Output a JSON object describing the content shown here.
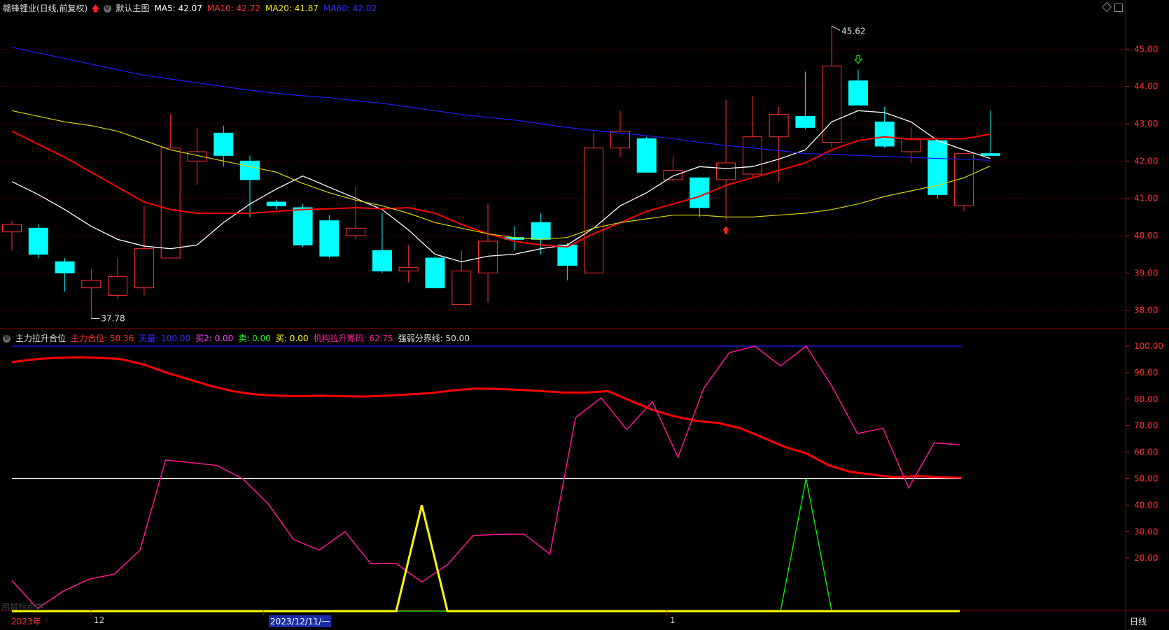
{
  "header": {
    "stock": "赣锋锂业(日线,前复权)",
    "template": "默认主图",
    "ma5": "MA5: 42.07",
    "ma10": "MA10: 42.72",
    "ma20": "MA20: 41.87",
    "ma60": "MA60: 42.02"
  },
  "indicator_header": {
    "name": "主力拉升合位",
    "main": "主力合位: 50.36",
    "sky": "天量: 100.00",
    "buy2": "买2: 0.00",
    "sell": "卖: 0.00",
    "buy": "买: 0.00",
    "inst": "机构拉升筹码: 62.75",
    "line": "强弱分界线: 50.00"
  },
  "bottom": {
    "year": "2023年",
    "m12": "12",
    "date": "2023/12/11/一",
    "m1": "1",
    "period": "日线",
    "hint": "用鼠标点中"
  },
  "colors": {
    "up": "#ff3232",
    "down": "#00ffff",
    "ma5": "#ffffff",
    "ma10": "#ff0000",
    "ma20": "#d8d800",
    "ma60": "#2020ff",
    "inst": "#ff1493",
    "main": "#ff0000",
    "buy": "#ffff00",
    "buy2": "#00ff00",
    "grid": "#5a0000"
  },
  "chart_data": [
    {
      "type": "candlestick",
      "yticks": [
        "45.00",
        "44.00",
        "43.00",
        "42.00",
        "41.00",
        "40.00",
        "39.00",
        "38.00"
      ],
      "ylim": [
        37.6,
        45.85
      ],
      "annotations": {
        "high_label": "45.62",
        "low_label": "37.78"
      },
      "candles": [
        {
          "o": 40.1,
          "c": 40.3,
          "h": 40.4,
          "l": 39.6
        },
        {
          "o": 40.2,
          "c": 39.5,
          "h": 40.3,
          "l": 39.4
        },
        {
          "o": 39.3,
          "c": 39.0,
          "h": 39.4,
          "l": 38.5
        },
        {
          "o": 38.6,
          "c": 38.8,
          "h": 39.1,
          "l": 37.78
        },
        {
          "o": 38.4,
          "c": 38.9,
          "h": 39.4,
          "l": 38.3
        },
        {
          "o": 38.6,
          "c": 39.65,
          "h": 40.8,
          "l": 38.4
        },
        {
          "o": 39.4,
          "c": 42.35,
          "h": 43.25,
          "l": 39.4
        },
        {
          "o": 42.0,
          "c": 42.25,
          "h": 42.9,
          "l": 41.35
        },
        {
          "o": 42.75,
          "c": 42.15,
          "h": 42.95,
          "l": 41.85
        },
        {
          "o": 42.0,
          "c": 41.5,
          "h": 42.15,
          "l": 40.5
        },
        {
          "o": 40.9,
          "c": 40.8,
          "h": 40.95,
          "l": 40.7
        },
        {
          "o": 40.75,
          "c": 39.75,
          "h": 40.85,
          "l": 39.7
        },
        {
          "o": 40.4,
          "c": 39.45,
          "h": 40.55,
          "l": 39.4
        },
        {
          "o": 40.0,
          "c": 40.2,
          "h": 41.3,
          "l": 39.9
        },
        {
          "o": 39.6,
          "c": 39.05,
          "h": 40.6,
          "l": 39.0
        },
        {
          "o": 39.05,
          "c": 39.15,
          "h": 39.75,
          "l": 38.75
        },
        {
          "o": 39.4,
          "c": 38.6,
          "h": 39.45,
          "l": 38.6
        },
        {
          "o": 38.15,
          "c": 39.05,
          "h": 39.6,
          "l": 38.15
        },
        {
          "o": 39.0,
          "c": 39.85,
          "h": 40.85,
          "l": 38.2
        },
        {
          "o": 39.95,
          "c": 39.9,
          "h": 40.25,
          "l": 39.6
        },
        {
          "o": 40.35,
          "c": 39.9,
          "h": 40.6,
          "l": 39.5
        },
        {
          "o": 39.75,
          "c": 39.2,
          "h": 39.8,
          "l": 38.8
        },
        {
          "o": 39.0,
          "c": 42.35,
          "h": 42.75,
          "l": 39.0
        },
        {
          "o": 42.35,
          "c": 42.8,
          "h": 43.35,
          "l": 42.1
        },
        {
          "o": 42.6,
          "c": 41.7,
          "h": 42.65,
          "l": 41.7
        },
        {
          "o": 41.5,
          "c": 41.75,
          "h": 42.15,
          "l": 41.45
        },
        {
          "o": 41.55,
          "c": 40.75,
          "h": 41.55,
          "l": 40.5
        },
        {
          "o": 41.5,
          "c": 41.95,
          "h": 43.65,
          "l": 40.4
        },
        {
          "o": 41.65,
          "c": 42.65,
          "h": 43.75,
          "l": 41.55
        },
        {
          "o": 42.65,
          "c": 43.25,
          "h": 43.45,
          "l": 41.45
        },
        {
          "o": 43.2,
          "c": 42.9,
          "h": 44.4,
          "l": 42.85
        },
        {
          "o": 42.5,
          "c": 44.55,
          "h": 45.62,
          "l": 42.35
        },
        {
          "o": 44.15,
          "c": 43.5,
          "h": 44.45,
          "l": 43.5
        },
        {
          "o": 43.05,
          "c": 42.4,
          "h": 43.45,
          "l": 42.35
        },
        {
          "o": 42.25,
          "c": 42.6,
          "h": 42.9,
          "l": 41.95
        },
        {
          "o": 42.55,
          "c": 41.1,
          "h": 42.55,
          "l": 41.0
        },
        {
          "o": 40.8,
          "c": 42.2,
          "h": 42.2,
          "l": 40.65
        },
        {
          "o": 42.2,
          "c": 42.15,
          "h": 43.35,
          "l": 42.15
        }
      ],
      "series": [
        {
          "name": "MA5",
          "values": [
            41.45,
            41.1,
            40.7,
            40.25,
            39.9,
            39.72,
            39.65,
            39.75,
            40.35,
            40.85,
            41.25,
            41.6,
            41.3,
            41.0,
            40.7,
            40.15,
            39.5,
            39.3,
            39.45,
            39.5,
            39.65,
            39.75,
            40.2,
            40.8,
            41.15,
            41.6,
            41.85,
            41.8,
            41.85,
            42.05,
            42.3,
            43.05,
            43.35,
            43.3,
            43.05,
            42.55,
            42.3,
            42.07
          ]
        },
        {
          "name": "MA10",
          "values": [
            42.8,
            42.45,
            42.1,
            41.7,
            41.3,
            40.9,
            40.7,
            40.6,
            40.6,
            40.6,
            40.65,
            40.7,
            40.72,
            40.75,
            40.72,
            40.75,
            40.6,
            40.3,
            40.05,
            39.85,
            39.75,
            39.7,
            40.05,
            40.35,
            40.65,
            40.85,
            41.05,
            41.35,
            41.55,
            41.75,
            41.95,
            42.3,
            42.55,
            42.65,
            42.58,
            42.6,
            42.6,
            42.72
          ]
        },
        {
          "name": "MA20",
          "values": [
            43.35,
            43.2,
            43.05,
            42.95,
            42.8,
            42.55,
            42.3,
            42.15,
            42.0,
            41.85,
            41.7,
            41.4,
            41.15,
            40.95,
            40.8,
            40.6,
            40.35,
            40.2,
            40.05,
            39.95,
            39.9,
            39.95,
            40.2,
            40.35,
            40.45,
            40.55,
            40.55,
            40.5,
            40.5,
            40.55,
            40.6,
            40.7,
            40.85,
            41.05,
            41.2,
            41.35,
            41.55,
            41.87
          ]
        },
        {
          "name": "MA60",
          "values": [
            45.05,
            44.9,
            44.75,
            44.6,
            44.45,
            44.3,
            44.2,
            44.1,
            44.0,
            43.9,
            43.82,
            43.75,
            43.7,
            43.62,
            43.55,
            43.45,
            43.35,
            43.25,
            43.17,
            43.1,
            43.0,
            42.9,
            42.82,
            42.75,
            42.68,
            42.6,
            42.5,
            42.42,
            42.35,
            42.28,
            42.2,
            42.18,
            42.15,
            42.12,
            42.1,
            42.07,
            42.05,
            42.02
          ]
        }
      ]
    },
    {
      "type": "line",
      "yticks": [
        "100.00",
        "90.00",
        "80.00",
        "70.00",
        "60.00",
        "50.00",
        "40.00",
        "30.00",
        "20.00"
      ],
      "ylim": [
        0,
        100
      ],
      "reference_lines": {
        "sky": 100,
        "boundary": 50
      },
      "series": [
        {
          "name": "主力合位",
          "values": [
            94.0,
            95.0,
            95.6,
            95.8,
            95.6,
            95.0,
            93.0,
            90.0,
            87.5,
            85.0,
            83.0,
            81.8,
            81.3,
            81.1,
            81.3,
            81.1,
            81.0,
            81.3,
            81.8,
            82.3,
            83.3,
            84.0,
            83.8,
            83.5,
            83.0,
            82.5,
            82.5,
            83.0,
            79.5,
            76.0,
            73.5,
            71.8,
            71.0,
            69.0,
            65.5,
            62.0,
            59.5,
            55.0,
            52.5,
            51.5,
            50.5,
            51.0,
            50.5,
            50.36
          ]
        },
        {
          "name": "机构拉升筹码",
          "values": [
            11.5,
            1.0,
            7.5,
            12.0,
            14.0,
            23.0,
            57.0,
            56.0,
            55.0,
            50.0,
            40.5,
            27.0,
            23.0,
            30.0,
            18.0,
            18.0,
            11.0,
            17.5,
            28.5,
            29.0,
            29.0,
            21.5,
            73.0,
            80.5,
            68.5,
            79.0,
            58.0,
            84.0,
            97.5,
            100.0,
            92.5,
            100.0,
            85.0,
            67.0,
            69.0,
            46.5,
            63.5,
            62.75
          ]
        },
        {
          "name": "买",
          "values": [
            0,
            0,
            0,
            0,
            0,
            0,
            0,
            0,
            0,
            0,
            0,
            0,
            0,
            0,
            0,
            0,
            40,
            0,
            0,
            0,
            0,
            0,
            0,
            0,
            0,
            0,
            0,
            0,
            0,
            0,
            0,
            0,
            0,
            0,
            0,
            0,
            0,
            0
          ]
        },
        {
          "name": "买2",
          "values": [
            0,
            0,
            0,
            0,
            0,
            0,
            0,
            0,
            0,
            0,
            0,
            0,
            0,
            0,
            0,
            0,
            0,
            0,
            0,
            0,
            0,
            0,
            0,
            0,
            0,
            0,
            0,
            0,
            0,
            0,
            0,
            50,
            0,
            0,
            0,
            0,
            0,
            0
          ]
        }
      ]
    }
  ]
}
